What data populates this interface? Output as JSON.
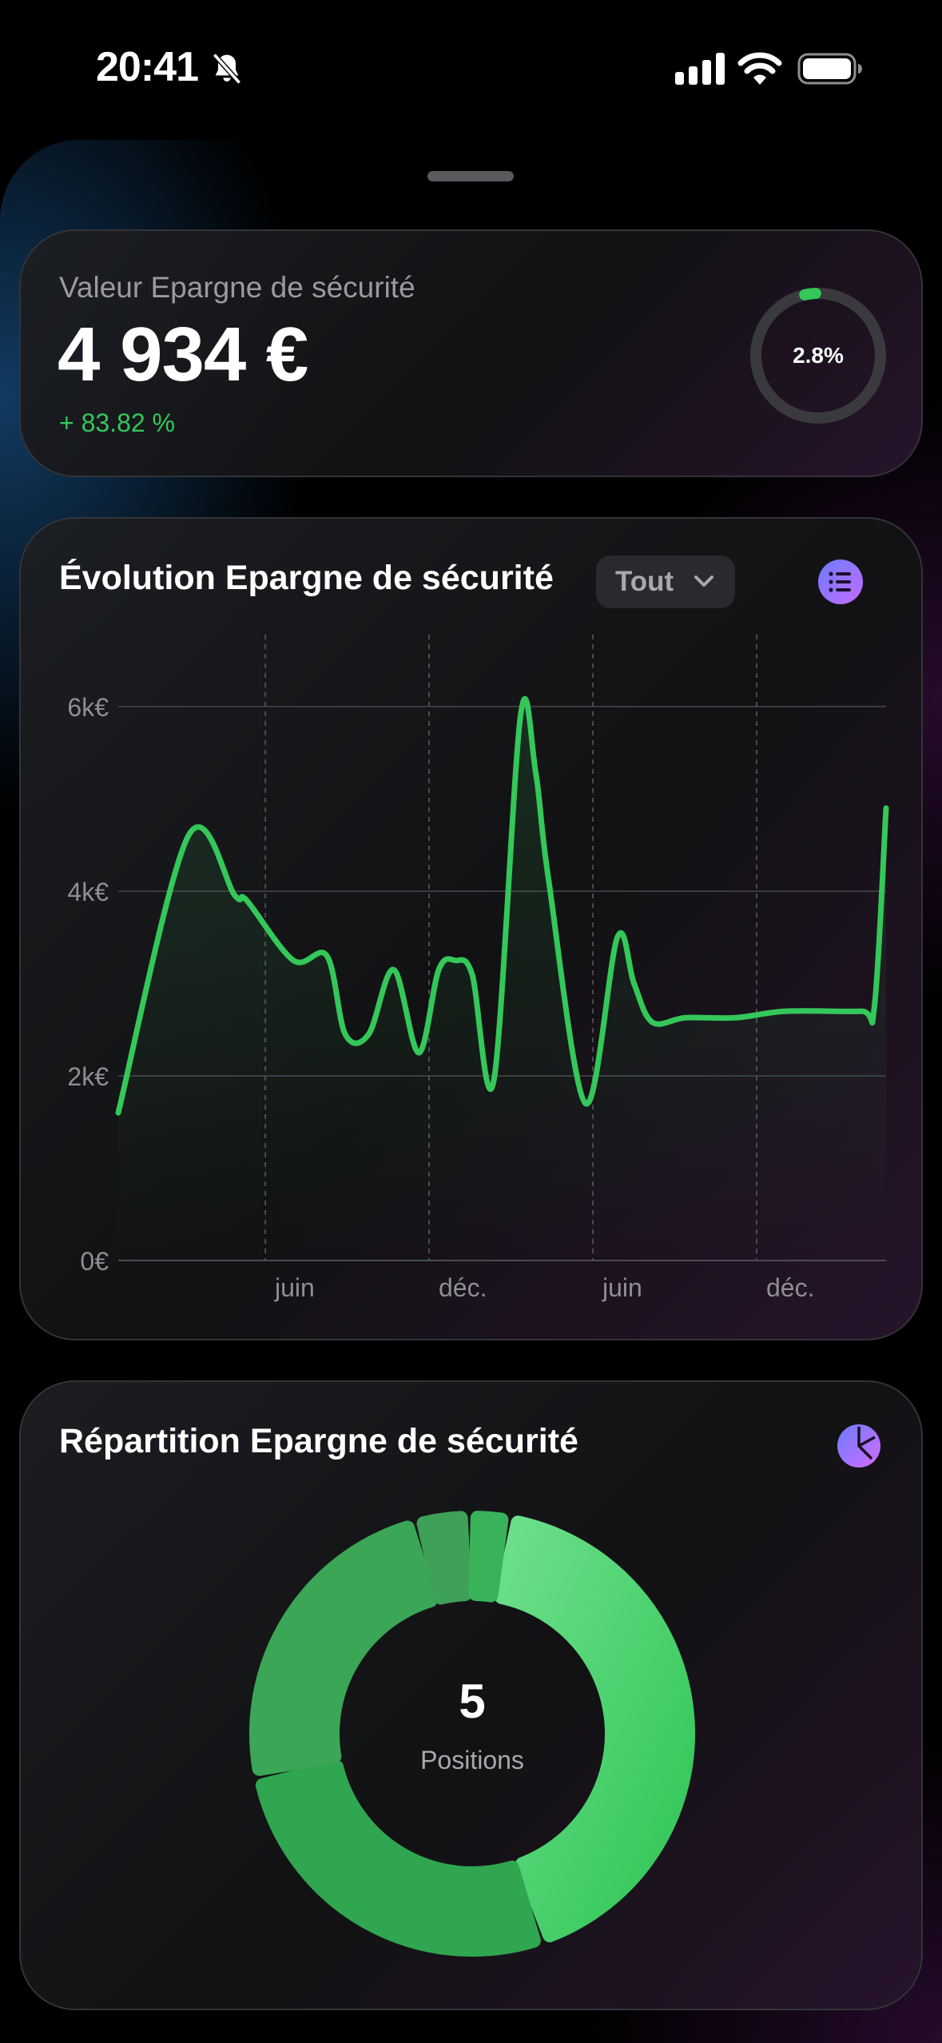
{
  "status_bar": {
    "time": "20:41"
  },
  "summary": {
    "label": "Valeur Epargne de sécurité",
    "amount": "4 934 €",
    "change": "+ 83.82 %",
    "ring_percent_label": "2.8%",
    "ring_value_percent": 2.8
  },
  "evolution": {
    "title": "Évolution Epargne de sécurité",
    "period_label": "Tout",
    "list_icon": "list-icon"
  },
  "distribution": {
    "title": "Répartition Epargne de sécurité",
    "pie_icon": "pie-chart-icon",
    "center_value": "5",
    "center_label": "Positions"
  },
  "colors": {
    "accent_green": "#34c759",
    "ring_track": "#3a3a3e",
    "button_gradient_start": "#6a7cff",
    "button_gradient_end": "#c46bff"
  },
  "chart_data": [
    {
      "type": "line",
      "unit": "€",
      "ylim": [
        0,
        6000
      ],
      "yticks": [
        0,
        2000,
        4000,
        6000
      ],
      "ytick_labels": [
        "0€",
        "2k€",
        "4k€",
        "6k€"
      ],
      "xtick_labels": [
        "juin",
        "déc.",
        "juin",
        "déc."
      ],
      "grid": true,
      "x": [
        0,
        4.2,
        7,
        7.7,
        10.5,
        12.5,
        13.6,
        15,
        16.5,
        18,
        19.2,
        20.2,
        21.2,
        22.5,
        24.1,
        25,
        25.8,
        28,
        29.9,
        30.9,
        32,
        34,
        37,
        40,
        44.5,
        45.3,
        46
      ],
      "values": [
        1600,
        4600,
        3950,
        3900,
        3250,
        3300,
        2450,
        2450,
        3150,
        2250,
        3150,
        3250,
        3100,
        1950,
        5900,
        5300,
        4100,
        1700,
        3500,
        3000,
        2580,
        2630,
        2630,
        2700,
        2700,
        2750,
        4900
      ]
    },
    {
      "type": "pie",
      "donut": true,
      "slice_count": 5,
      "values": [
        42,
        27,
        24,
        4,
        3
      ],
      "colors": [
        "#48cf6d",
        "#2fa64f",
        "#3aa656",
        "#3fa058",
        "#39b35a"
      ]
    }
  ]
}
